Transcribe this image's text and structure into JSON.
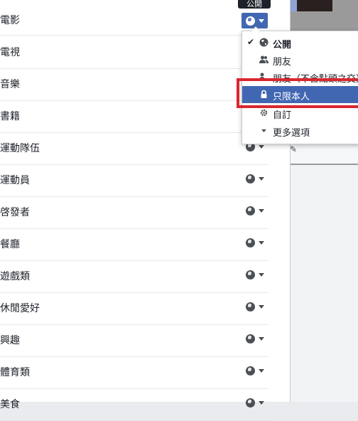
{
  "tooltip": "公開",
  "rows": [
    {
      "label": "電影",
      "privacy": "公開"
    },
    {
      "label": "電視",
      "privacy": ""
    },
    {
      "label": "音樂",
      "privacy": ""
    },
    {
      "label": "書籍",
      "privacy": ""
    },
    {
      "label": "運動隊伍",
      "privacy": "公開"
    },
    {
      "label": "運動員",
      "privacy": "公開"
    },
    {
      "label": "啓發者",
      "privacy": "公開"
    },
    {
      "label": "餐廳",
      "privacy": "公開"
    },
    {
      "label": "遊戲類",
      "privacy": "公開"
    },
    {
      "label": "休閒愛好",
      "privacy": "公開"
    },
    {
      "label": "興趣",
      "privacy": "公開"
    },
    {
      "label": "體育類",
      "privacy": "公開"
    },
    {
      "label": "美食",
      "privacy": "公開"
    }
  ],
  "dropdown": {
    "items": [
      {
        "label": "公開",
        "icon": "globe-icon",
        "checked": true,
        "bold": true
      },
      {
        "label": "朋友",
        "icon": "friends-icon",
        "checked": false,
        "bold": false
      },
      {
        "label": "朋友（不含點頭之交）",
        "icon": "friends-except-icon",
        "checked": false,
        "bold": false
      },
      {
        "label": "只限本人",
        "icon": "lock-icon",
        "checked": false,
        "selected": true,
        "bold": false
      },
      {
        "label": "自訂",
        "icon": "gear-icon",
        "checked": false,
        "bold": false
      },
      {
        "label": "更多選項",
        "icon": "caret-down-icon",
        "checked": false,
        "bold": false
      }
    ]
  },
  "colors": {
    "accent": "#4267b2",
    "highlight": "#d9272e",
    "text": "#1d2129"
  }
}
